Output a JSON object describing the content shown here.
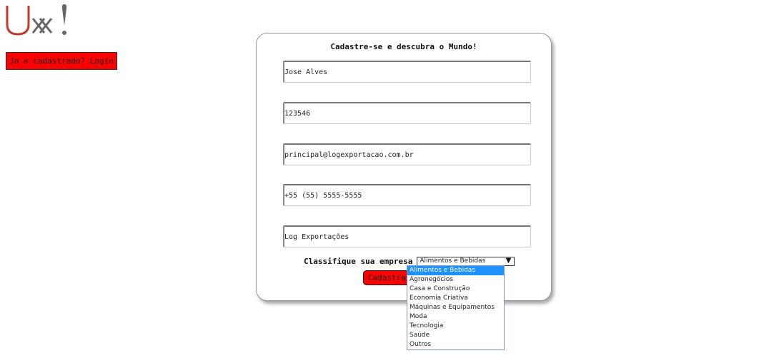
{
  "logo": {
    "text": "Ux!"
  },
  "login_button": {
    "label": "Ja e cadastrado? Login"
  },
  "form": {
    "title": "Cadastre-se e descubra o Mundo!",
    "fields": [
      {
        "name": "name",
        "value": "Jose Alves"
      },
      {
        "name": "id",
        "value": "123546"
      },
      {
        "name": "email",
        "value": "principal@logexportacao.com.br"
      },
      {
        "name": "phone",
        "value": "+55 (55) 5555-5555"
      },
      {
        "name": "company",
        "value": "Log Exportações"
      }
    ],
    "classify_label": "Classifique sua empresa",
    "select_value": "Alimentos e Bebidas",
    "submit_label": "Cadastrar"
  },
  "dropdown": {
    "options": [
      "Alimentos e Bebidas",
      "Agronegócios",
      "Casa e Construção",
      "Economia Criativa",
      "Máquinas e Equipamentos",
      "Moda",
      "Tecnologia",
      "Saúde",
      "Outros"
    ],
    "selected_index": 0
  },
  "colors": {
    "accent": "#ff0000",
    "logo_red": "#c0392b",
    "logo_gray": "#666666",
    "highlight": "#1e90ff"
  }
}
